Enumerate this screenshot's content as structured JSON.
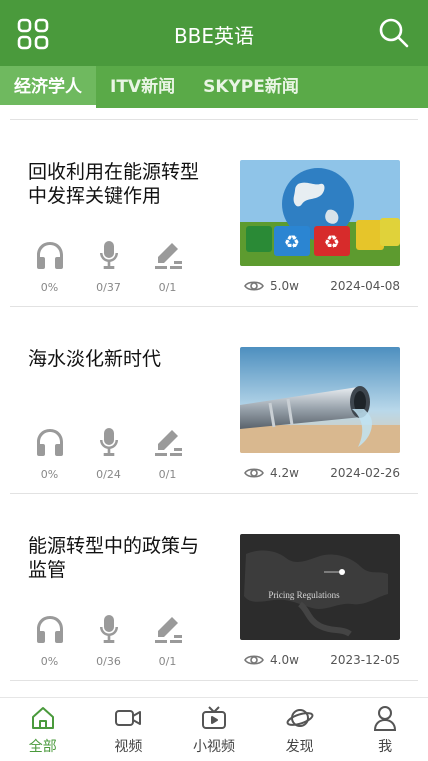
{
  "app": {
    "title": "BBE英语"
  },
  "tabs": [
    {
      "label": "经济学人",
      "active": true
    },
    {
      "label": "ITV新闻",
      "active": false
    },
    {
      "label": "SKYPE新闻",
      "active": false
    }
  ],
  "articles": [
    {
      "title": "回收利用在能源转型中发挥关键作用",
      "listen": "0%",
      "speak": "0/37",
      "write": "0/1",
      "views": "5.0w",
      "date": "2024-04-08",
      "thumb": "globe-recycling-bins"
    },
    {
      "title": "海水淡化新时代",
      "listen": "0%",
      "speak": "0/24",
      "write": "0/1",
      "views": "4.2w",
      "date": "2024-02-26",
      "thumb": "water-pipe"
    },
    {
      "title": "能源转型中的政策与监管",
      "listen": "0%",
      "speak": "0/36",
      "write": "0/1",
      "views": "4.0w",
      "date": "2023-12-05",
      "thumb": "dark-map",
      "thumb_caption": "Pricing Regulations"
    }
  ],
  "bottom_nav": [
    {
      "label": "全部",
      "icon": "home-icon",
      "active": true
    },
    {
      "label": "视频",
      "icon": "video-icon",
      "active": false
    },
    {
      "label": "小视频",
      "icon": "tv-icon",
      "active": false
    },
    {
      "label": "发现",
      "icon": "planet-icon",
      "active": false
    },
    {
      "label": "我",
      "icon": "user-icon",
      "active": false
    }
  ],
  "colors": {
    "brand_green": "#4a9a3c",
    "tab_green": "#5aaa48",
    "icon_gray": "#9a9a9a"
  }
}
